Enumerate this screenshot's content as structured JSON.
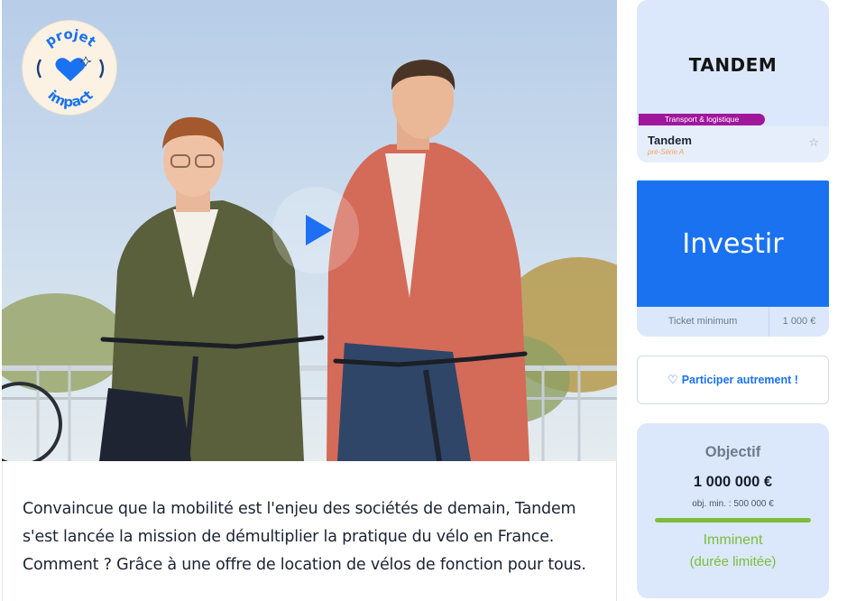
{
  "hero": {
    "badge_line1": "projet",
    "badge_line2": "impact",
    "play_label": "play"
  },
  "description": "Convaincue que la mobilité est l'enjeu des sociétés de demain, Tandem s'est lancée la mission de démultiplier la pratique du vélo en France. Comment ? Grâce à une offre de location de vélos de fonction pour tous.",
  "company": {
    "logo_text": "TANDEM",
    "sector": "Transport & logistique",
    "name": "Tandem",
    "round": "pré-Série A",
    "favorite_icon": "star-outline-icon"
  },
  "invest": {
    "button_label": "Investir",
    "ticket_label": "Ticket minimum",
    "ticket_value": "1 000 €"
  },
  "participate": {
    "label": "Participer autrement !",
    "icon": "heart-outline-icon"
  },
  "goal": {
    "title": "Objectif",
    "amount": "1 000 000 €",
    "min": "obj. min. : 500 000 €",
    "progress_percent": 100,
    "status": "Imminent",
    "note": "(durée limitée)"
  },
  "colors": {
    "primary": "#1a72f0",
    "card_bg": "#dbe8fb",
    "sector_badge": "#a0179c",
    "success": "#7bbd3a",
    "round_text": "#f2a25a"
  }
}
